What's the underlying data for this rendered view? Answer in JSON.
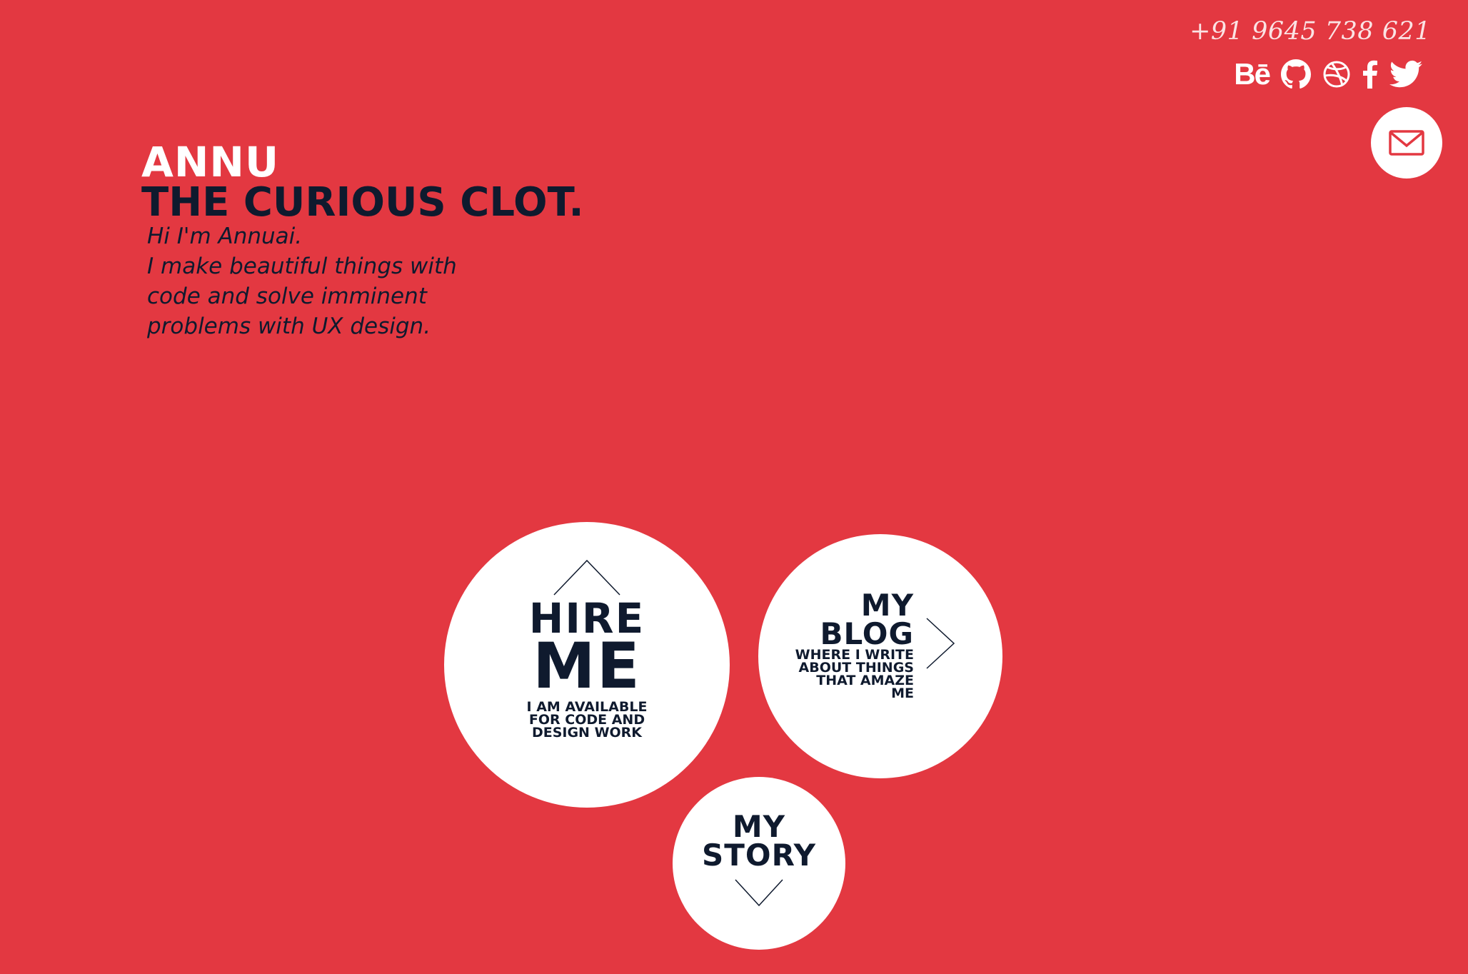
{
  "contact": {
    "phone": "+91 9645 738 621",
    "socials": [
      {
        "name": "behance-icon",
        "label": "Bē"
      },
      {
        "name": "github-icon"
      },
      {
        "name": "dribbble-icon"
      },
      {
        "name": "facebook-icon"
      },
      {
        "name": "twitter-icon"
      }
    ],
    "mail_icon": "mail-icon"
  },
  "header": {
    "name": "ANNU",
    "tagline": "THE CURIOUS CLOT."
  },
  "intro": {
    "line1": "Hi I'm Annuai.",
    "line2": "I make beautiful things with",
    "line3": "code and solve imminent",
    "line4": "problems with UX design."
  },
  "circles": {
    "hire": {
      "title_1": "HIRE",
      "title_2": "ME",
      "subtitle_1": "I AM AVAILABLE",
      "subtitle_2": "FOR CODE AND",
      "subtitle_3": "DESIGN WORK",
      "arrow_icon": "chevron-up-icon"
    },
    "blog": {
      "title_1": "MY",
      "title_2": "BLOG",
      "subtitle_1": "WHERE I WRITE",
      "subtitle_2": "ABOUT THINGS",
      "subtitle_3": "THAT AMAZE",
      "subtitle_4": "ME",
      "arrow_icon": "chevron-right-icon"
    },
    "story": {
      "title_1": "MY",
      "title_2": "STORY",
      "arrow_icon": "chevron-down-icon"
    }
  },
  "colors": {
    "background": "#e33841",
    "dark_text": "#0f1a2e",
    "circle": "#ffffff"
  }
}
